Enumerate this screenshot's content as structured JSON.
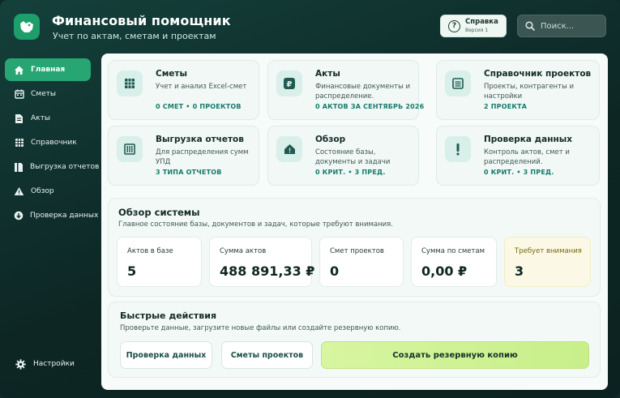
{
  "header": {
    "title": "Финансовый помощник",
    "subtitle": "Учет по актам, сметам и проектам",
    "help_label": "Справка",
    "help_sub": "Версия 1",
    "search_placeholder": "Поиск..."
  },
  "sidebar": {
    "items": [
      {
        "label": "Главная",
        "icon": "home-icon",
        "active": true
      },
      {
        "label": "Сметы",
        "icon": "calendar-icon"
      },
      {
        "label": "Акты",
        "icon": "document-icon"
      },
      {
        "label": "Справочник",
        "icon": "grid-icon"
      },
      {
        "label": "Выгрузка отчетов",
        "icon": "report-icon"
      },
      {
        "label": "Обзор",
        "icon": "warning-icon"
      },
      {
        "label": "Проверка данных",
        "icon": "download-icon"
      }
    ],
    "settings_label": "Настройки"
  },
  "cards": [
    {
      "title": "Сметы",
      "desc": "Учет и анализ Excel-смет",
      "stat": "0 СМЕТ • 0 ПРОЕКТОВ",
      "icon": "table-icon"
    },
    {
      "title": "Акты",
      "desc": "Финансовые документы и распределение.",
      "stat": "0 АКТОВ ЗА СЕНТЯБРЬ 2026",
      "icon": "ruble-icon"
    },
    {
      "title": "Справочник проектов",
      "desc": "Проекты, контрагенты и настройки",
      "stat": "2 ПРОЕКТА",
      "icon": "list-icon"
    },
    {
      "title": "Выгрузка отчетов",
      "desc": "Для распределения сумм УПД",
      "stat": "3 ТИПА ОТЧЕТОВ",
      "icon": "columns-icon"
    },
    {
      "title": "Обзор",
      "desc": "Состояние базы, документы и задачи",
      "stat": "0 КРИТ. • 3 ПРЕД.",
      "icon": "alert-icon"
    },
    {
      "title": "Проверка данных",
      "desc": "Контроль актов, смет и распределений.",
      "stat": "0 КРИТ. • 3 ПРЕД.",
      "icon": "exclamation-icon"
    }
  ],
  "overview": {
    "title": "Обзор системы",
    "subtitle": "Главное состояние базы, документов и задач, которые требуют внимания.",
    "metrics": [
      {
        "label": "Актов в базе",
        "value": "5"
      },
      {
        "label": "Сумма актов",
        "value": "488 891,33 ₽"
      },
      {
        "label": "Смет проектов",
        "value": "0"
      },
      {
        "label": "Сумма по сметам",
        "value": "0,00 ₽"
      },
      {
        "label": "Требует внимания",
        "value": "3"
      }
    ]
  },
  "actions": {
    "title": "Быстрые действия",
    "subtitle": "Проверьте данные, загрузите новые файлы или создайте резервную копию.",
    "buttons": [
      "Проверка данных",
      "Сметы проектов",
      "Создать резервную копию"
    ]
  },
  "colors": {
    "accent": "#27a673",
    "background": "#0f2a28",
    "warning_card": "#fbf8e6",
    "primary_button": "#cdf294"
  }
}
